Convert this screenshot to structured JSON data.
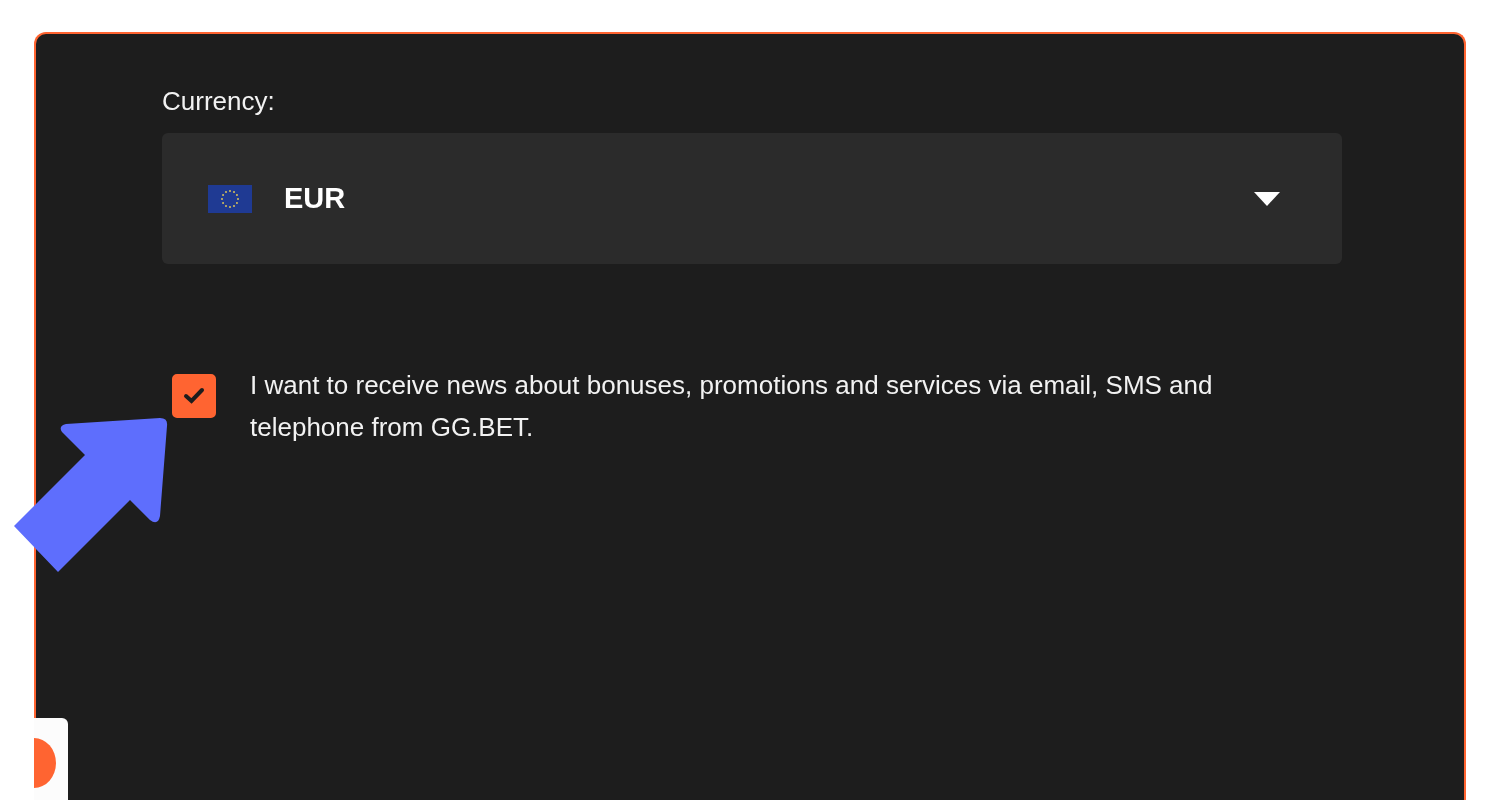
{
  "currency": {
    "label": "Currency:",
    "value": "EUR",
    "expanded": false
  },
  "consent": {
    "checked": true,
    "text": "I want to receive news about bonuses, promotions and services via email, SMS and telephone from GG.BET."
  }
}
